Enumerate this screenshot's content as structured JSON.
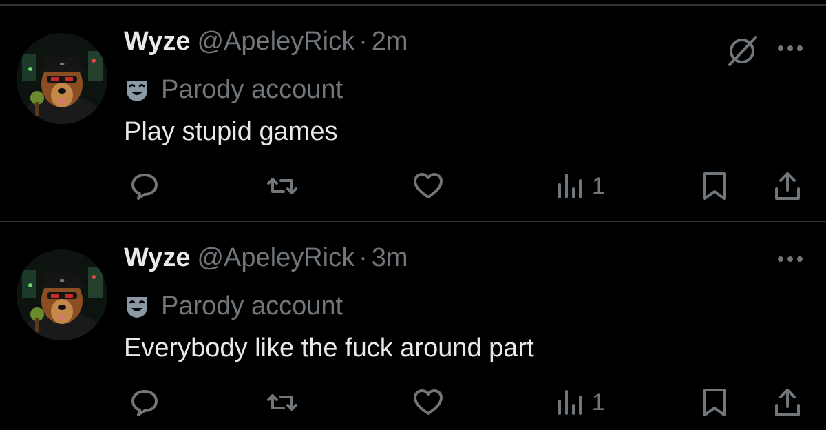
{
  "tweets": [
    {
      "display_name": "Wyze",
      "handle": "@ApeleyRick",
      "separator": "·",
      "time": "2m",
      "label": "Parody account",
      "text": "Play stupid games",
      "views": "1",
      "avatar_icon": "dog-avatar",
      "label_icon": "theater-mask-icon",
      "extra_icon": "grok-icon"
    },
    {
      "display_name": "Wyze",
      "handle": "@ApeleyRick",
      "separator": "·",
      "time": "3m",
      "label": "Parody account",
      "text": "Everybody like the fuck around part",
      "views": "1",
      "avatar_icon": "dog-avatar",
      "label_icon": "theater-mask-icon"
    }
  ],
  "colors": {
    "background": "#000000",
    "primary_text": "#e7e9ea",
    "secondary_text": "#71767b",
    "divider": "#2f3336"
  }
}
